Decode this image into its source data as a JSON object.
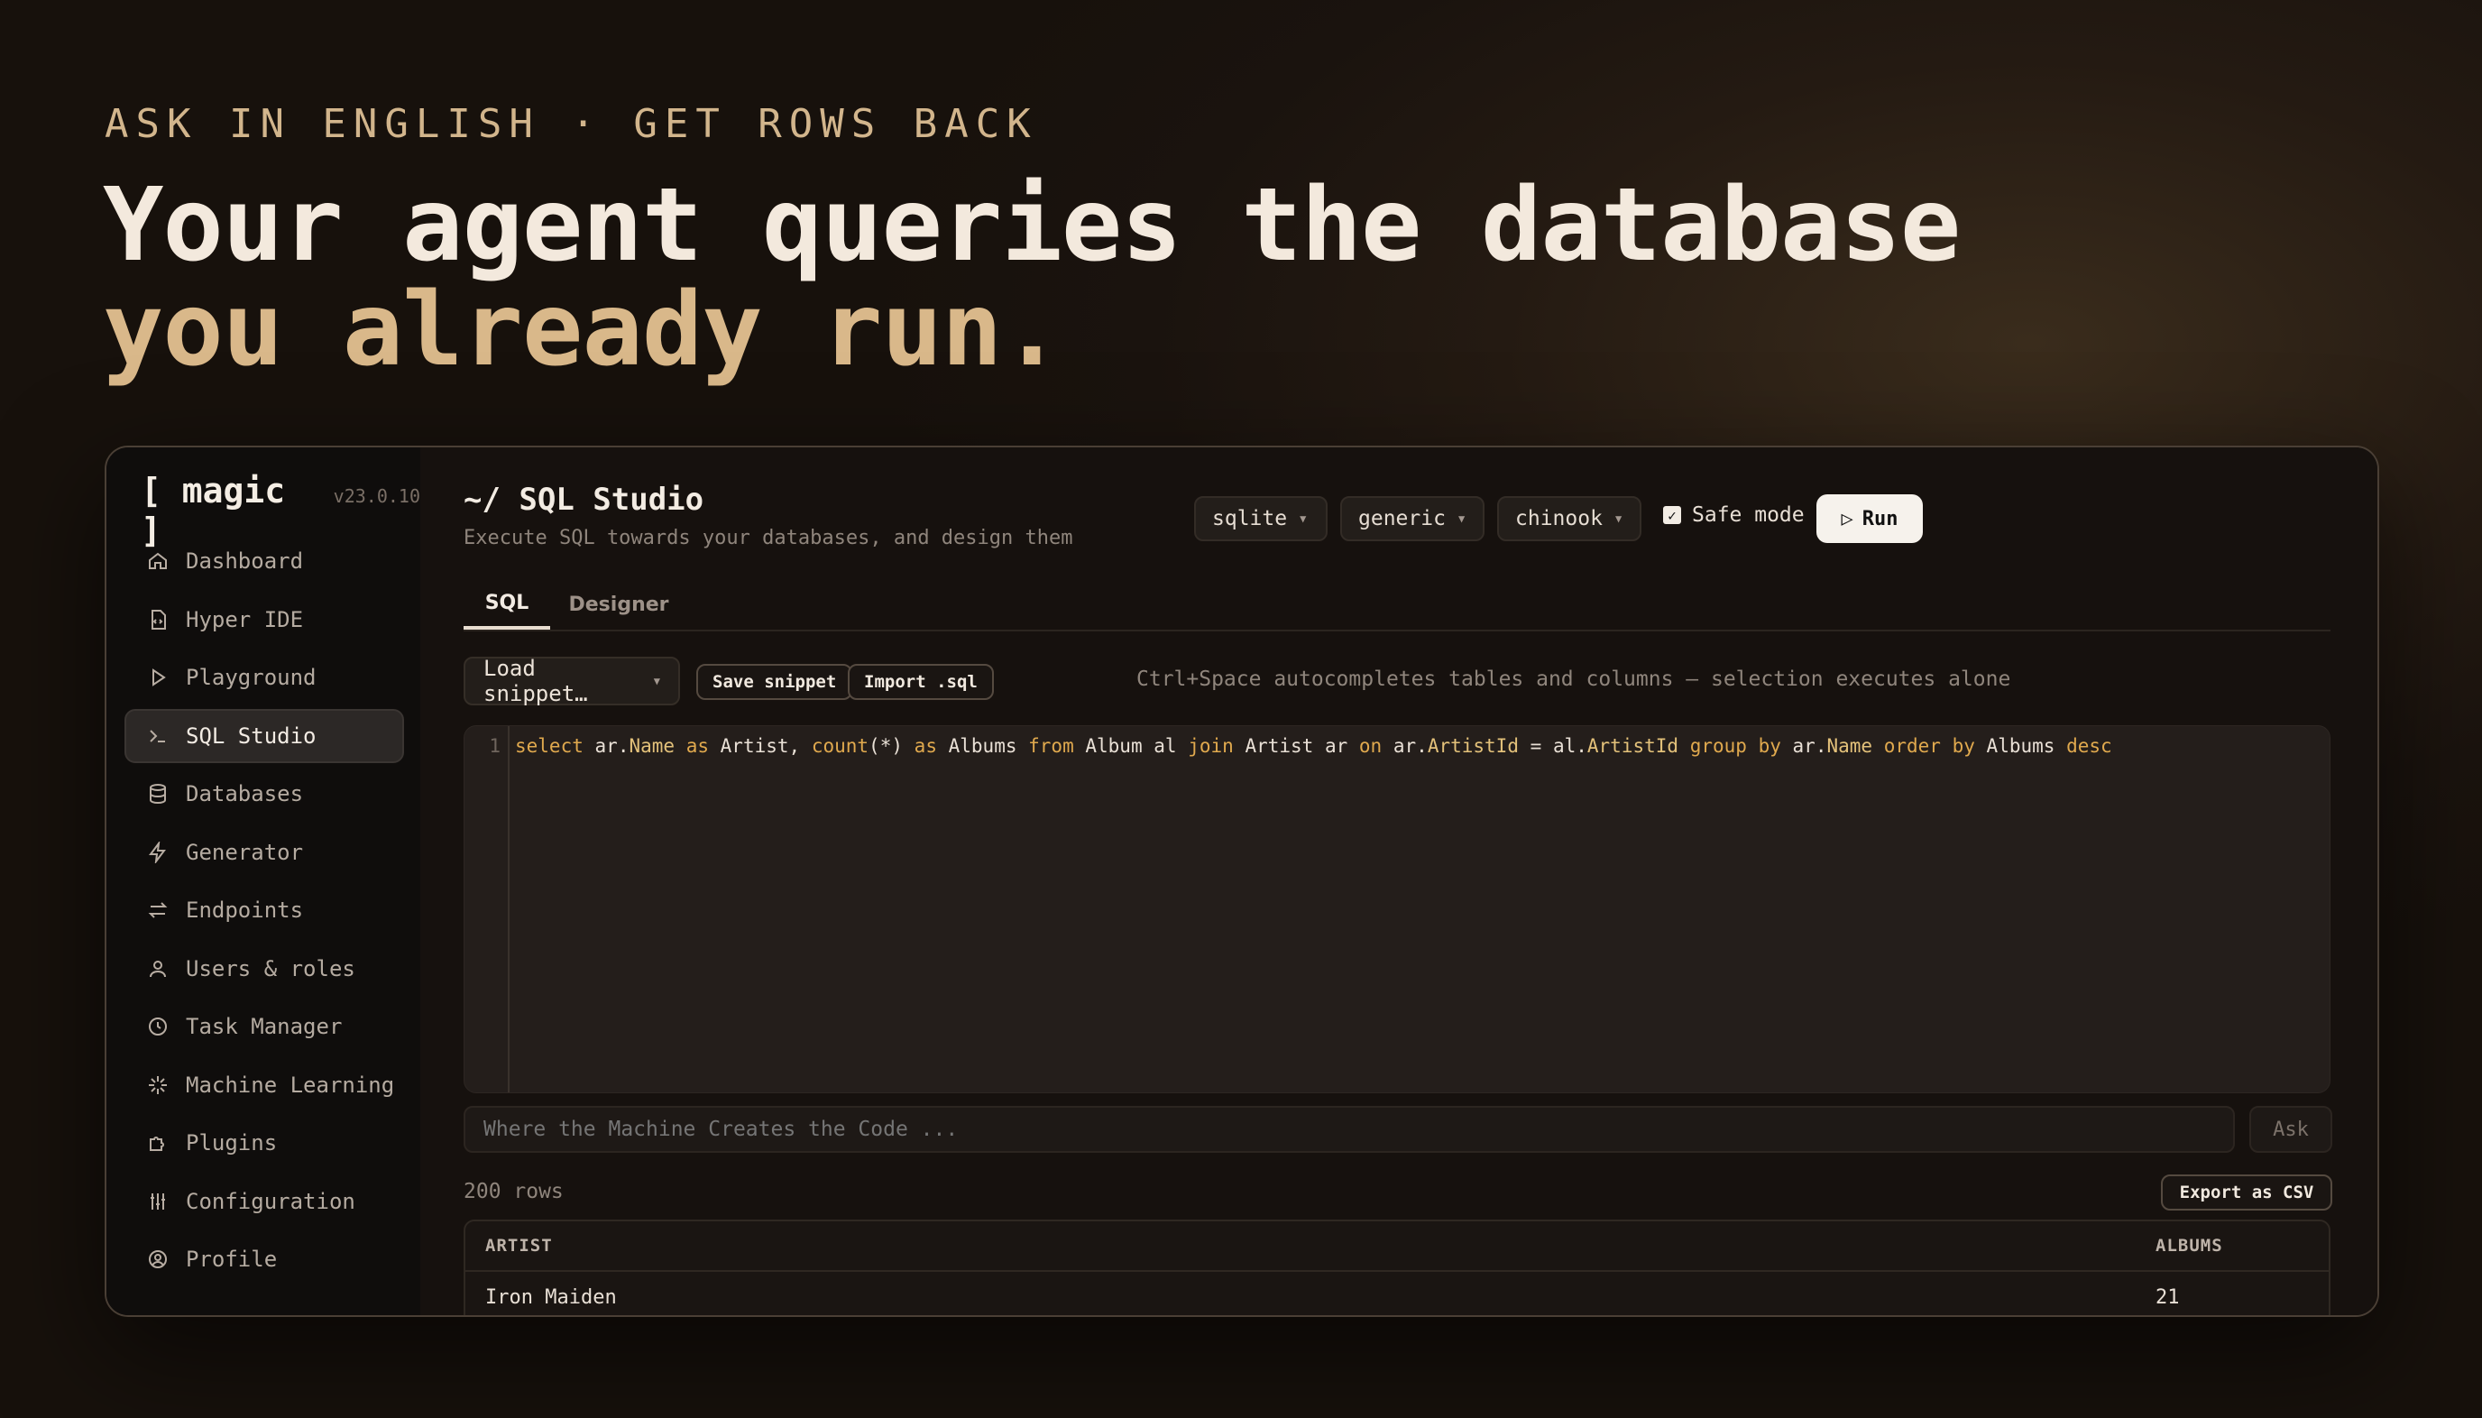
{
  "hero": {
    "eyebrow": "ASK IN ENGLISH · GET ROWS BACK",
    "headline_line1": "Your agent queries the database",
    "headline_line2": "you already run."
  },
  "sidebar": {
    "brand": "[ magic ]",
    "version": "v23.0.10",
    "items": [
      {
        "label": "Dashboard",
        "icon": "home-icon"
      },
      {
        "label": "Hyper IDE",
        "icon": "file-code-icon"
      },
      {
        "label": "Playground",
        "icon": "play-icon"
      },
      {
        "label": "SQL Studio",
        "icon": "terminal-icon",
        "active": true
      },
      {
        "label": "Databases",
        "icon": "database-icon"
      },
      {
        "label": "Generator",
        "icon": "lightning-icon"
      },
      {
        "label": "Endpoints",
        "icon": "arrows-icon"
      },
      {
        "label": "Users & roles",
        "icon": "user-icon"
      },
      {
        "label": "Task Manager",
        "icon": "clock-icon"
      },
      {
        "label": "Machine Learning",
        "icon": "sparkle-icon"
      },
      {
        "label": "Plugins",
        "icon": "puzzle-icon"
      },
      {
        "label": "Configuration",
        "icon": "sliders-icon"
      },
      {
        "label": "Profile",
        "icon": "profile-icon"
      }
    ]
  },
  "header": {
    "title": "~/ SQL Studio",
    "subtitle": "Execute SQL towards your databases, and design them",
    "db_type": "sqlite",
    "connection": "generic",
    "database": "chinook",
    "safe_mode_label": "Safe mode",
    "safe_mode_checked": true,
    "run_label": "Run",
    "run_icon": "▷"
  },
  "tabs": [
    {
      "label": "SQL",
      "active": true
    },
    {
      "label": "Designer",
      "active": false
    }
  ],
  "toolbar": {
    "load_snippet": "Load snippet…",
    "save_snippet": "Save snippet",
    "import_sql": "Import .sql",
    "hint": "Ctrl+Space autocompletes tables and columns — selection executes alone"
  },
  "editor": {
    "line_number": "1",
    "sql": "select ar.Name as Artist, count(*) as Albums from Album al join Artist ar on ar.ArtistId = al.ArtistId group by ar.Name order by Albums desc"
  },
  "ask": {
    "placeholder": "Where the Machine Creates the Code ...",
    "button": "Ask"
  },
  "results": {
    "row_count": "200 rows",
    "export_label": "Export as CSV",
    "columns": [
      "ARTIST",
      "ALBUMS"
    ],
    "rows": [
      [
        "Iron Maiden",
        "21"
      ]
    ]
  },
  "colors": {
    "accent": "#d9b88a",
    "keyword": "#e0a94e",
    "background": "#17110c"
  }
}
